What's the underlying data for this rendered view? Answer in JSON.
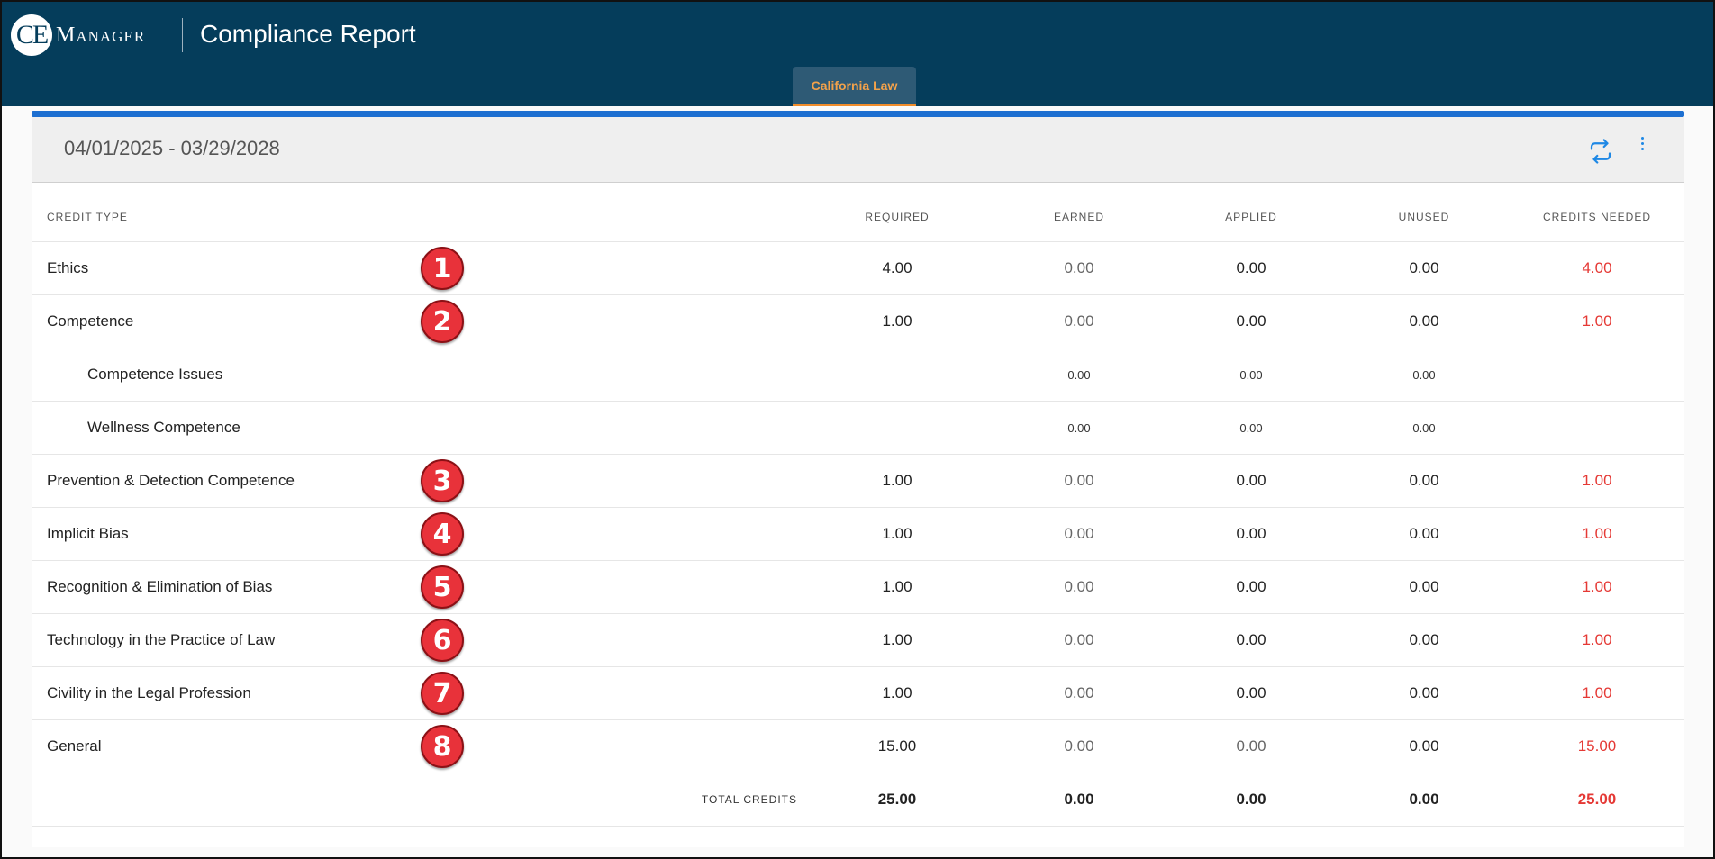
{
  "header": {
    "logo_mark": "CE",
    "logo_word": "Manager",
    "app_title": "Compliance Report",
    "tab_label": "California Law"
  },
  "period": "04/01/2025 - 03/29/2028",
  "icons": {
    "sync": "sync-icon",
    "menu": "kebab-menu-icon"
  },
  "colors": {
    "header": "#053d5b",
    "tab_accent": "#f18c2a",
    "bar": "#1d6fd1",
    "needed": "#e53935",
    "badge": "#e8323a"
  },
  "columns": {
    "credit_type": "CREDIT TYPE",
    "required": "REQUIRED",
    "earned": "EARNED",
    "applied": "APPLIED",
    "unused": "UNUSED",
    "needed": "CREDITS NEEDED"
  },
  "rows": [
    {
      "name": "Ethics",
      "badge": "1",
      "required": "4.00",
      "earned": "0.00",
      "applied": "0.00",
      "unused": "0.00",
      "needed": "4.00"
    },
    {
      "name": "Competence",
      "badge": "2",
      "required": "1.00",
      "earned": "0.00",
      "applied": "0.00",
      "unused": "0.00",
      "needed": "1.00"
    },
    {
      "name": "Competence Issues",
      "earned": "0.00",
      "applied": "0.00",
      "unused": "0.00"
    },
    {
      "name": "Wellness Competence",
      "earned": "0.00",
      "applied": "0.00",
      "unused": "0.00"
    },
    {
      "name": "Prevention & Detection Competence",
      "badge": "3",
      "required": "1.00",
      "earned": "0.00",
      "applied": "0.00",
      "unused": "0.00",
      "needed": "1.00"
    },
    {
      "name": "Implicit Bias",
      "badge": "4",
      "required": "1.00",
      "earned": "0.00",
      "applied": "0.00",
      "unused": "0.00",
      "needed": "1.00"
    },
    {
      "name": "Recognition & Elimination of Bias",
      "badge": "5",
      "required": "1.00",
      "earned": "0.00",
      "applied": "0.00",
      "unused": "0.00",
      "needed": "1.00"
    },
    {
      "name": "Technology in the Practice of Law",
      "badge": "6",
      "required": "1.00",
      "earned": "0.00",
      "applied": "0.00",
      "unused": "0.00",
      "needed": "1.00"
    },
    {
      "name": "Civility in the Legal Profession",
      "badge": "7",
      "required": "1.00",
      "earned": "0.00",
      "applied": "0.00",
      "unused": "0.00",
      "needed": "1.00"
    },
    {
      "name": "General",
      "badge": "8",
      "required": "15.00",
      "earned": "0.00",
      "applied": "0.00",
      "unused": "0.00",
      "needed": "15.00"
    }
  ],
  "totals": {
    "label": "TOTAL CREDITS",
    "required": "25.00",
    "earned": "0.00",
    "applied": "0.00",
    "unused": "0.00",
    "needed": "25.00"
  }
}
